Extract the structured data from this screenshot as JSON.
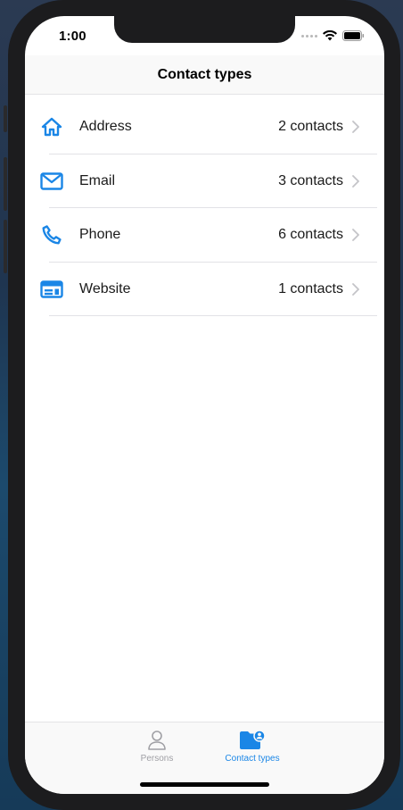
{
  "status_bar": {
    "time": "1:00"
  },
  "nav": {
    "title": "Contact types"
  },
  "rows": [
    {
      "label": "Address",
      "count": "2 contacts",
      "icon": "home-icon"
    },
    {
      "label": "Email",
      "count": "3 contacts",
      "icon": "envelope-icon"
    },
    {
      "label": "Phone",
      "count": "6 contacts",
      "icon": "phone-icon"
    },
    {
      "label": "Website",
      "count": "1 contacts",
      "icon": "web-card-icon"
    }
  ],
  "tabs": [
    {
      "label": "Persons",
      "icon": "person-icon",
      "active": false
    },
    {
      "label": "Contact types",
      "icon": "folder-person-icon",
      "active": true
    }
  ],
  "colors": {
    "accent": "#1a86e6",
    "inactive": "#a0a0a5"
  }
}
